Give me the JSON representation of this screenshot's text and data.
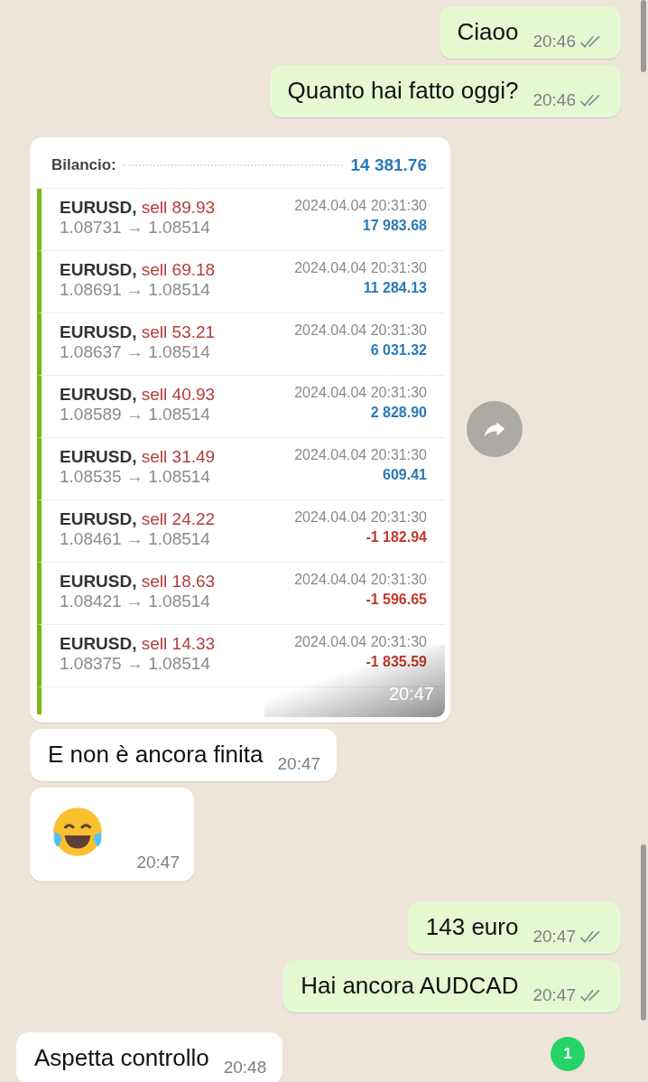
{
  "messages": [
    {
      "kind": "text",
      "outgoing": true,
      "text": "Ciaoo",
      "time": "20:46",
      "delivered": true
    },
    {
      "kind": "text",
      "outgoing": true,
      "text": "Quanto hai fatto oggi?",
      "time": "20:46",
      "delivered": true
    },
    {
      "kind": "image",
      "outgoing": false,
      "time": "20:47",
      "screenshot": {
        "balance_label": "Bilancio:",
        "balance": "14 381.76",
        "trades": [
          {
            "symbol": "EURUSD,",
            "side": "sell 89.93",
            "prices": "1.08731 → 1.08514",
            "date": "2024.04.04 20:31:30",
            "profit": "17 983.68",
            "positive": true
          },
          {
            "symbol": "EURUSD,",
            "side": "sell 69.18",
            "prices": "1.08691 → 1.08514",
            "date": "2024.04.04 20:31:30",
            "profit": "11 284.13",
            "positive": true
          },
          {
            "symbol": "EURUSD,",
            "side": "sell 53.21",
            "prices": "1.08637 → 1.08514",
            "date": "2024.04.04 20:31:30",
            "profit": "6 031.32",
            "positive": true
          },
          {
            "symbol": "EURUSD,",
            "side": "sell 40.93",
            "prices": "1.08589 → 1.08514",
            "date": "2024.04.04 20:31:30",
            "profit": "2 828.90",
            "positive": true
          },
          {
            "symbol": "EURUSD,",
            "side": "sell 31.49",
            "prices": "1.08535 → 1.08514",
            "date": "2024.04.04 20:31:30",
            "profit": "609.41",
            "positive": true
          },
          {
            "symbol": "EURUSD,",
            "side": "sell 24.22",
            "prices": "1.08461 → 1.08514",
            "date": "2024.04.04 20:31:30",
            "profit": "-1 182.94",
            "positive": false
          },
          {
            "symbol": "EURUSD,",
            "side": "sell 18.63",
            "prices": "1.08421 → 1.08514",
            "date": "2024.04.04 20:31:30",
            "profit": "-1 596.65",
            "positive": false
          },
          {
            "symbol": "EURUSD,",
            "side": "sell 14.33",
            "prices": "1.08375 → 1.08514",
            "date": "2024.04.04 20:31:30",
            "profit": "-1 835.59",
            "positive": false
          }
        ]
      }
    },
    {
      "kind": "text",
      "outgoing": false,
      "text": "E non è ancora finita",
      "time": "20:47"
    },
    {
      "kind": "emoji",
      "outgoing": false,
      "time": "20:47"
    },
    {
      "kind": "text",
      "outgoing": true,
      "text": "143 euro",
      "time": "20:47",
      "delivered": true
    },
    {
      "kind": "text",
      "outgoing": true,
      "text": "Hai ancora AUDCAD",
      "time": "20:47",
      "delivered": true
    },
    {
      "kind": "text",
      "outgoing": false,
      "text": "Aspetta controllo",
      "time": "20:48"
    }
  ],
  "unread_badge": "1"
}
